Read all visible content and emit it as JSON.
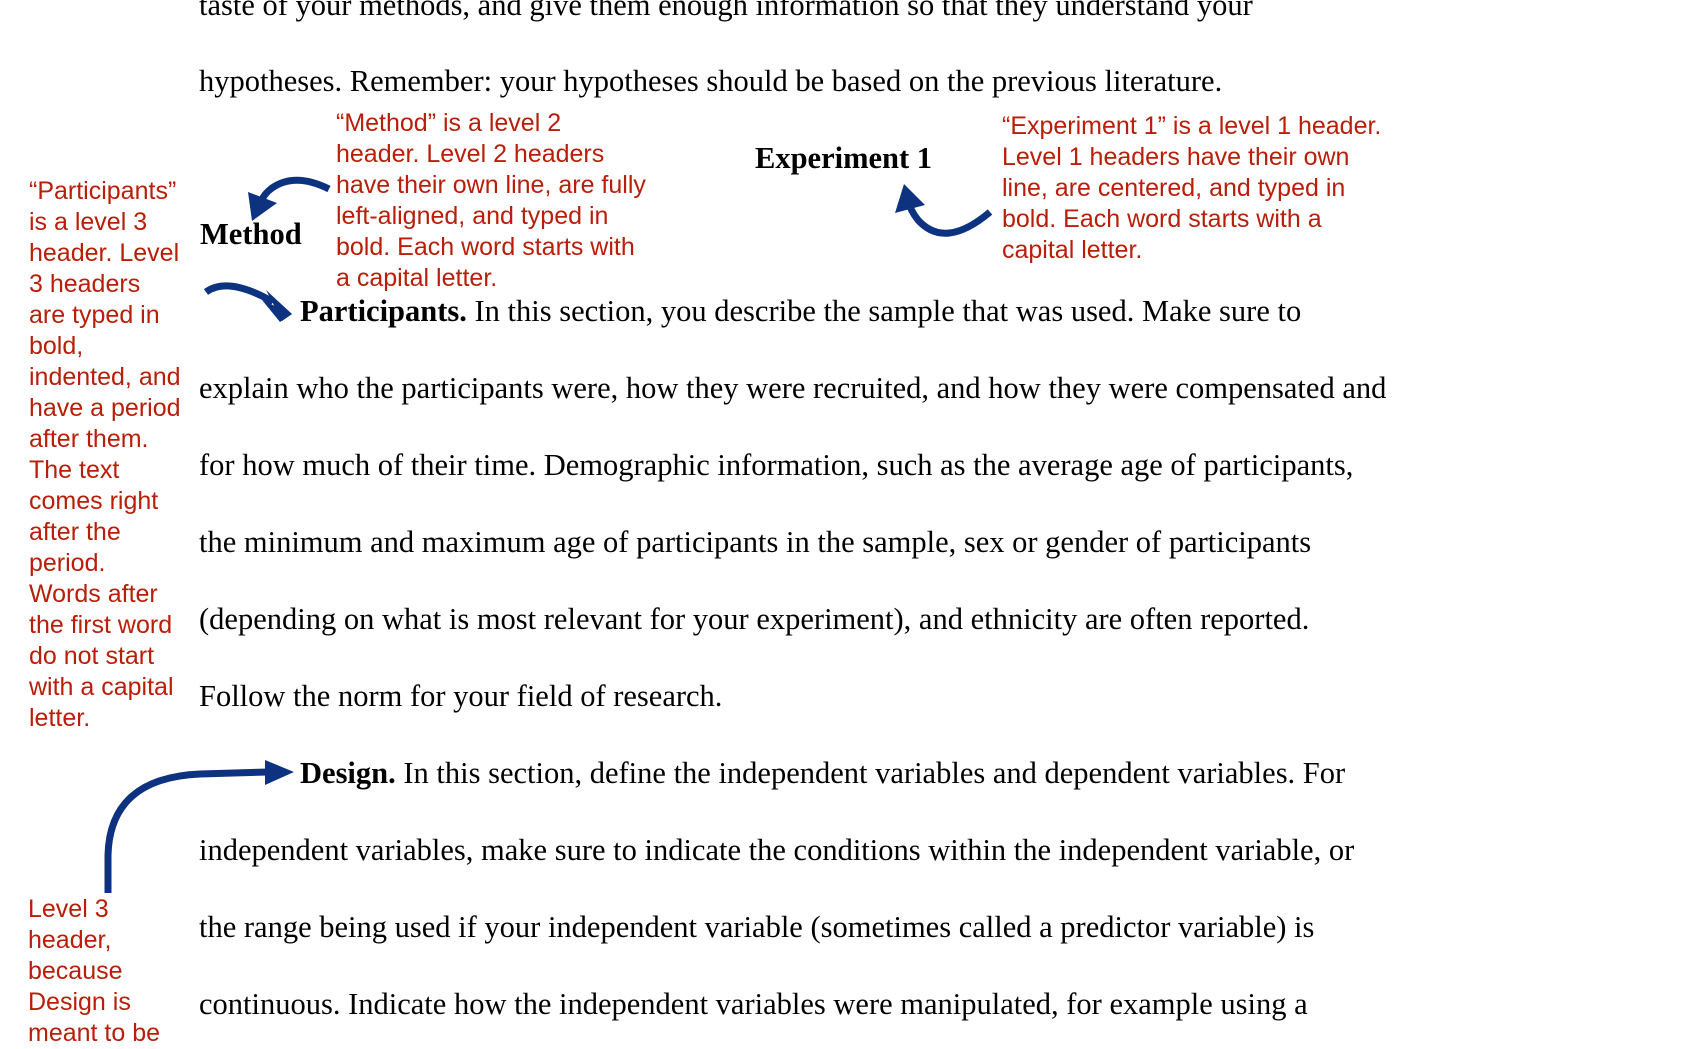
{
  "colors": {
    "body_text": "#000000",
    "annotation_text": "#b81e08",
    "arrow": "#0d3380"
  },
  "intro_lines": [
    "taste of your methods, and give them enough information so that they understand your",
    "hypotheses. Remember: your hypotheses should be based on the previous literature."
  ],
  "headings": {
    "level1": "Experiment 1",
    "level2": "Method"
  },
  "participants": {
    "run_in_heading": "Participants.",
    "first_line_rest": " In this section, you describe the sample that was used. Make sure to",
    "lines": [
      "explain who the participants were, how they were recruited, and how they were compensated and",
      "for how much of their time. Demographic information, such as the average age of participants,",
      "the minimum and maximum age of participants in the sample, sex or gender of participants",
      "(depending on what is most relevant for your experiment), and ethnicity are often reported.",
      "Follow the norm for your field of research."
    ]
  },
  "design": {
    "run_in_heading": "Design.",
    "first_line_rest": " In this section, define the independent variables and dependent variables. For",
    "lines": [
      "independent variables, make sure to indicate the conditions within the independent variable, or",
      "the range being used if your independent variable (sometimes called a predictor variable) is",
      "continuous. Indicate how the independent variables were manipulated, for example using a"
    ]
  },
  "annotations": {
    "level1_note": [
      "“Experiment 1” is a level 1 header.",
      "Level 1 headers have their own",
      "line, are centered, and typed in",
      "bold. Each word starts with a",
      "capital letter."
    ],
    "level2_note": [
      "“Method” is a level 2",
      "header. Level 2 headers",
      "have their own line, are fully",
      "left-aligned, and typed in",
      "bold. Each word starts with",
      "a capital letter."
    ],
    "level3_note": [
      "“Participants”",
      "is a level 3",
      "header. Level",
      "3 headers",
      "are typed in",
      "bold,",
      "indented, and",
      "have a period",
      "after them.",
      "The text",
      "comes right",
      "after the",
      "period.",
      "Words after",
      "the first word",
      "do not start",
      "with a capital",
      "letter."
    ],
    "design_note": [
      "Level 3",
      "header,",
      "because",
      "Design is",
      "meant to be"
    ]
  },
  "icons": {
    "arrows": [
      "curved-arrow-to-experiment-1",
      "curved-arrow-to-method",
      "curved-arrow-to-participants",
      "curved-arrow-to-design"
    ]
  }
}
